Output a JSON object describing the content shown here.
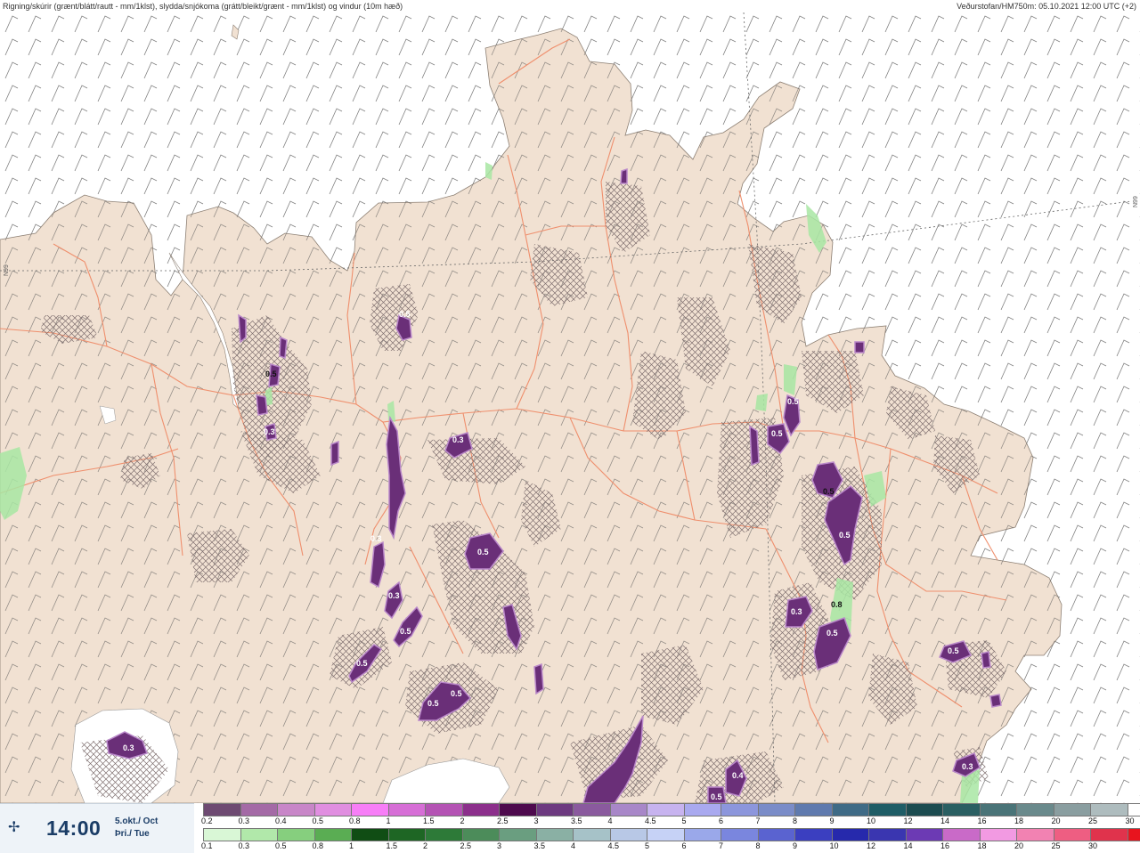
{
  "header": {
    "title_left": "Rigning/skúrir (grænt/blátt/rautt - mm/1klst), slydda/snjókoma (grátt/bleikt/grænt - mm/1klst) og vindur (10m hæð)",
    "title_right": "Veðurstofan/HM750m: 05.10.2021 12:00 UTC (+2)"
  },
  "map": {
    "grid_label_left": "N99",
    "grid_label_right": "N99",
    "colors": {
      "sea": "#ffffff",
      "land": "#f1e1d2",
      "roads": "#ef8f6d",
      "hatch": "#7f6f6f",
      "snow_light": "#b988c9",
      "snow_dark": "#6a2f78",
      "rain_green": "#a8e6a3",
      "glacier": "#ffffff"
    },
    "value_labels": [
      {
        "text": "0.5",
        "dark": false
      },
      {
        "text": "0.3",
        "dark": false
      },
      {
        "text": "0.5",
        "dark": false
      },
      {
        "text": "0.3",
        "dark": false
      },
      {
        "text": "0.5",
        "dark": false
      },
      {
        "text": "0.3",
        "dark": false
      },
      {
        "text": "0.5",
        "dark": false
      },
      {
        "text": "0.5",
        "dark": false
      },
      {
        "text": "0.5",
        "dark": false
      },
      {
        "text": "0.3",
        "dark": false
      },
      {
        "text": "0.5",
        "dark": false
      },
      {
        "text": "0.5",
        "dark": false
      },
      {
        "text": "0.5",
        "dark": false
      },
      {
        "text": "0.5",
        "dark": false
      },
      {
        "text": "0.3",
        "dark": false
      },
      {
        "text": "0.8",
        "dark": true
      },
      {
        "text": "0.5",
        "dark": false
      },
      {
        "text": "0.5",
        "dark": false
      },
      {
        "text": "0.5",
        "dark": false
      },
      {
        "text": "0.4",
        "dark": false
      },
      {
        "text": "0.3",
        "dark": false
      },
      {
        "text": "0.3",
        "dark": false
      },
      {
        "text": "0.5",
        "dark": false
      }
    ]
  },
  "time_panel": {
    "icon": "wind-compass-icon",
    "time": "14:00",
    "date_line1": "5.okt./ Oct",
    "date_line2": "Þri./ Tue"
  },
  "legend": {
    "snow": {
      "labels": [
        "0.2",
        "0.3",
        "0.4",
        "0.5",
        "0.8",
        "1",
        "1.5",
        "2",
        "2.5",
        "3",
        "3.5",
        "4",
        "4.5",
        "5",
        "6",
        "7",
        "8",
        "9",
        "10",
        "12",
        "14",
        "16",
        "18",
        "20",
        "25",
        "30"
      ],
      "colors": [
        "#6e4a72",
        "#a46aa6",
        "#c886c8",
        "#e08ee0",
        "#f77ef7",
        "#d66ed6",
        "#b453b4",
        "#8c2f8c",
        "#4e0a4e",
        "#6d3a80",
        "#8a5a9e",
        "#a887c8",
        "#c7b3ef",
        "#a9a9ef",
        "#8c96dc",
        "#7a8cc8",
        "#5f7aae",
        "#3f6b86",
        "#1f5d66",
        "#1c4c50",
        "#2a5f62",
        "#4a7478",
        "#6a8a8c",
        "#8a9ea0",
        "#aebcbe",
        "#ffffff"
      ]
    },
    "rain": {
      "labels": [
        "0.1",
        "0.3",
        "0.5",
        "0.8",
        "1",
        "1.5",
        "2",
        "2.5",
        "3",
        "3.5",
        "4",
        "4.5",
        "5",
        "6",
        "7",
        "8",
        "9",
        "10",
        "12",
        "14",
        "16",
        "18",
        "20",
        "25",
        "30"
      ],
      "colors": [
        "#d9f7d6",
        "#b1e8aa",
        "#86cf7e",
        "#5aad53",
        "#104d14",
        "#1e6624",
        "#2d7a38",
        "#4c8c5a",
        "#6a9e80",
        "#8ab0a4",
        "#a6c2c8",
        "#b8c8e6",
        "#c6d2f6",
        "#9aa8ea",
        "#7a86de",
        "#5a63d0",
        "#3b3fc0",
        "#2629ac",
        "#3a36b0",
        "#6c3ab4",
        "#c96ac8",
        "#f29ae2",
        "#f282b2",
        "#ee5e82",
        "#e0334c",
        "#e8141e"
      ]
    }
  }
}
